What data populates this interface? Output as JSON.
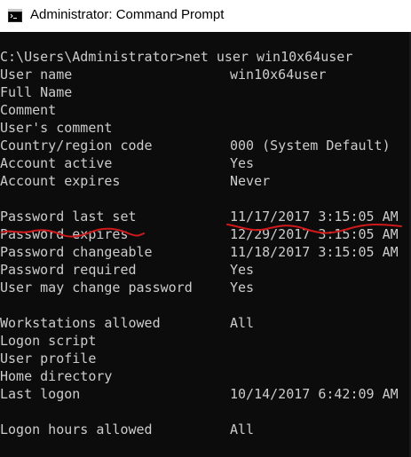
{
  "window": {
    "title": "Administrator: Command Prompt",
    "icon": "cmd-icon"
  },
  "console": {
    "prompt": "C:\\Users\\Administrator>net user win10x64user",
    "rows": [
      {
        "label": "User name",
        "value": "win10x64user"
      },
      {
        "label": "Full Name",
        "value": ""
      },
      {
        "label": "Comment",
        "value": ""
      },
      {
        "label": "User's comment",
        "value": ""
      },
      {
        "label": "Country/region code",
        "value": "000 (System Default)"
      },
      {
        "label": "Account active",
        "value": "Yes"
      },
      {
        "label": "Account expires",
        "value": "Never"
      },
      {
        "label": "",
        "value": ""
      },
      {
        "label": "Password last set",
        "value": "11/17/2017 3:15:05 AM"
      },
      {
        "label": "Password expires",
        "value": "12/29/2017 3:15:05 AM"
      },
      {
        "label": "Password changeable",
        "value": "11/18/2017 3:15:05 AM"
      },
      {
        "label": "Password required",
        "value": "Yes"
      },
      {
        "label": "User may change password",
        "value": "Yes"
      },
      {
        "label": "",
        "value": ""
      },
      {
        "label": "Workstations allowed",
        "value": "All"
      },
      {
        "label": "Logon script",
        "value": ""
      },
      {
        "label": "User profile",
        "value": ""
      },
      {
        "label": "Home directory",
        "value": ""
      },
      {
        "label": "Last logon",
        "value": "10/14/2017 6:42:09 AM"
      },
      {
        "label": "",
        "value": ""
      },
      {
        "label": "Logon hours allowed",
        "value": "All"
      }
    ]
  },
  "colors": {
    "console_bg": "#0c0c0c",
    "console_text": "#cccccc",
    "annotation": "#d0191b"
  }
}
